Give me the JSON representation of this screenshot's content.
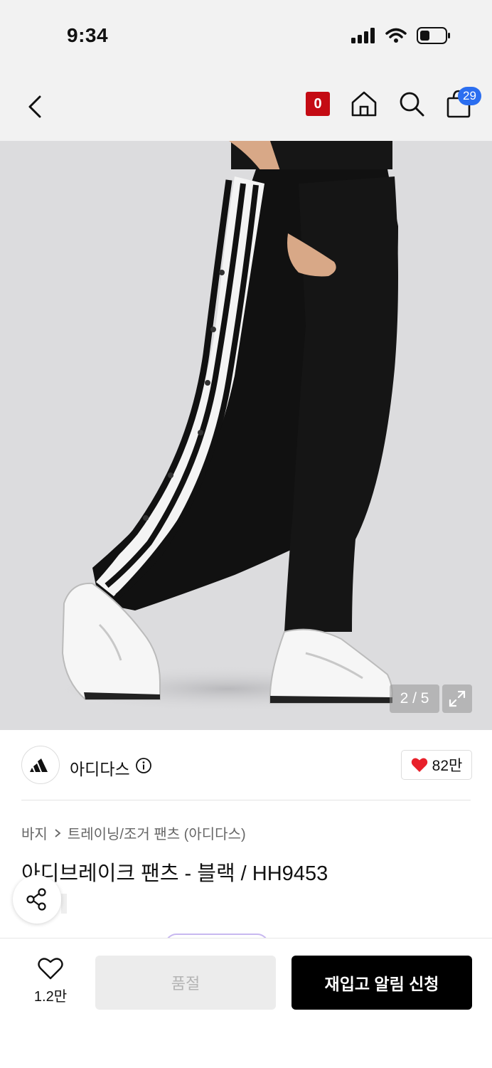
{
  "status_bar": {
    "time": "9:34"
  },
  "nav": {
    "zero_badge": "0",
    "cart_count": "29"
  },
  "gallery": {
    "page_indicator": "2 / 5"
  },
  "brand": {
    "name": "아디다스",
    "likes": "82만"
  },
  "breadcrumb": {
    "category": "바지",
    "subcategory": "트레이닝/조거 팬츠 (아디다스)"
  },
  "product": {
    "title": "아디브레이크 팬츠 - 블랙 / HH9453"
  },
  "bottom_bar": {
    "wish_count": "1.2만",
    "soldout_label": "품절",
    "restock_label": "재입고 알림 신청"
  },
  "icons": [
    "back-chevron-icon",
    "home-icon",
    "search-icon",
    "shopping-bag-icon",
    "expand-icon",
    "info-icon",
    "heart-icon",
    "share-icon",
    "heart-outline-icon"
  ],
  "colors": {
    "accent_red": "#c40b14",
    "badge_blue": "#2b6ef0",
    "heart_red": "#e8202a"
  }
}
